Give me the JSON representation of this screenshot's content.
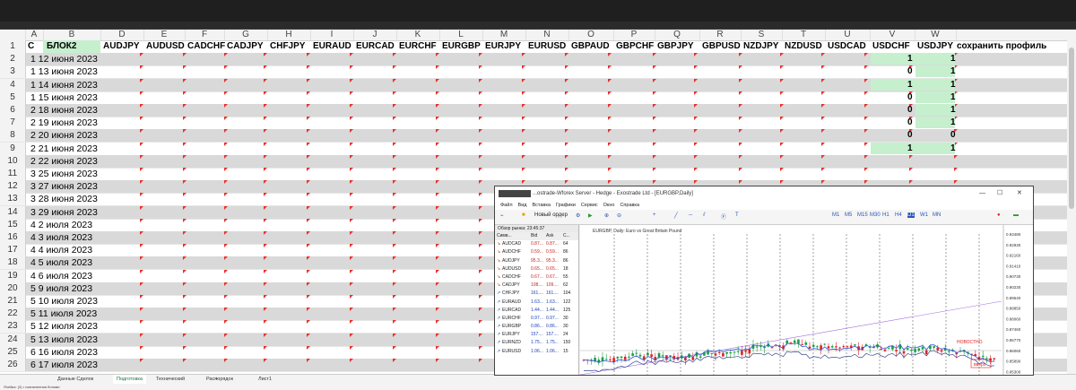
{
  "sheet": {
    "columns": [
      "A",
      "B",
      "D",
      "E",
      "F",
      "G",
      "H",
      "I",
      "J",
      "K",
      "L",
      "M",
      "N",
      "O",
      "P",
      "Q",
      "R",
      "S",
      "T",
      "U",
      "V",
      "W"
    ],
    "header_row": {
      "a": "С",
      "b": "БЛОК2",
      "pairs": [
        "AUDJPY",
        "AUDUSD",
        "CADCHF",
        "CADJPY",
        "CHFJPY",
        "EURAUD",
        "EURCAD",
        "EURCHF",
        "EURGBP",
        "EURJPY",
        "EURUSD",
        "GBPAUD",
        "GBPCHF",
        "GBPJPY",
        "GBPUSD",
        "NZDJPY",
        "NZDUSD",
        "USDCAD",
        "USDCHF",
        "USDJPY"
      ],
      "last": "сохранить профиль"
    },
    "rows": [
      {
        "n": "2",
        "a": "1",
        "date": "12 июня 2023",
        "v": "1",
        "w": "1"
      },
      {
        "n": "3",
        "a": "1",
        "date": "13 июня 2023",
        "v": "0",
        "w": "1"
      },
      {
        "n": "4",
        "a": "1",
        "date": "14 июня 2023",
        "v": "1",
        "w": "1"
      },
      {
        "n": "5",
        "a": "1",
        "date": "15 июня 2023",
        "v": "0",
        "w": "1"
      },
      {
        "n": "6",
        "a": "2",
        "date": "18 июня 2023",
        "v": "0",
        "w": "1"
      },
      {
        "n": "7",
        "a": "2",
        "date": "19 июня 2023",
        "v": "0",
        "w": "1"
      },
      {
        "n": "8",
        "a": "2",
        "date": "20 июня 2023",
        "v": "0",
        "w": "0"
      },
      {
        "n": "9",
        "a": "2",
        "date": "21 июня 2023",
        "v": "1",
        "w": "1"
      },
      {
        "n": "10",
        "a": "2",
        "date": "22 июня 2023",
        "v": "",
        "w": ""
      },
      {
        "n": "11",
        "a": "3",
        "date": "25 июня 2023",
        "v": "",
        "w": ""
      },
      {
        "n": "12",
        "a": "3",
        "date": "27 июня 2023",
        "v": "",
        "w": ""
      },
      {
        "n": "13",
        "a": "3",
        "date": "28 июня 2023",
        "v": "",
        "w": ""
      },
      {
        "n": "14",
        "a": "3",
        "date": "29 июня 2023",
        "v": "",
        "w": ""
      },
      {
        "n": "15",
        "a": "4",
        "date": "2 июля 2023",
        "v": "",
        "w": ""
      },
      {
        "n": "16",
        "a": "4",
        "date": "3 июля 2023",
        "v": "",
        "w": ""
      },
      {
        "n": "17",
        "a": "4",
        "date": "4 июля 2023",
        "v": "",
        "w": ""
      },
      {
        "n": "18",
        "a": "4",
        "date": "5 июля 2023",
        "v": "",
        "w": ""
      },
      {
        "n": "19",
        "a": "4",
        "date": "6 июля 2023",
        "v": "",
        "w": ""
      },
      {
        "n": "20",
        "a": "5",
        "date": "9 июля 2023",
        "v": "",
        "w": ""
      },
      {
        "n": "21",
        "a": "5",
        "date": "10 июля 2023",
        "v": "",
        "w": ""
      },
      {
        "n": "22",
        "a": "5",
        "date": "11 июля 2023",
        "v": "",
        "w": ""
      },
      {
        "n": "23",
        "a": "5",
        "date": "12 июля 2023",
        "v": "",
        "w": ""
      },
      {
        "n": "24",
        "a": "5",
        "date": "13 июля 2023",
        "v": "",
        "w": ""
      },
      {
        "n": "25",
        "a": "6",
        "date": "16 июля 2023",
        "v": "",
        "w": ""
      },
      {
        "n": "26",
        "a": "6",
        "date": "17 июля 2023",
        "v": "",
        "w": ""
      }
    ]
  },
  "tabs": [
    "Данные Сделок",
    "Подготовка",
    "Технический",
    "Распорядок",
    "Лист1"
  ],
  "mt4": {
    "title": "...ostrade-Wforex Server - Hedge - Exostrade Ltd - [EURGBP,Daily]",
    "menu": [
      "Файл",
      "Вид",
      "Вставка",
      "Графики",
      "Сервис",
      "Окно",
      "Справка"
    ],
    "new_order": "Новый ордер",
    "timeframes": [
      "M1",
      "M5",
      "M15",
      "M30",
      "H1",
      "H4",
      "D1",
      "W1",
      "MN"
    ],
    "market_watch_header": "Обзор рынка: 23:45:37",
    "mw_cols": [
      "Симв...",
      "Bid",
      "Ask",
      "С..."
    ],
    "symbols": [
      {
        "s": "AUDCAD",
        "b": "0.87...",
        "a": "0.87...",
        "sp": "64"
      },
      {
        "s": "AUDCHF",
        "b": "0.59...",
        "a": "0.59...",
        "sp": "86"
      },
      {
        "s": "AUDJPY",
        "b": "95.3...",
        "a": "95.3...",
        "sp": "86"
      },
      {
        "s": "AUDUSD",
        "b": "0.65...",
        "a": "0.65...",
        "sp": "18"
      },
      {
        "s": "CADCHF",
        "b": "0.67...",
        "a": "0.67...",
        "sp": "55"
      },
      {
        "s": "CADJPY",
        "b": "108....",
        "a": "109....",
        "sp": "62"
      },
      {
        "s": "CHFJPY",
        "b": "161....",
        "a": "161....",
        "sp": "104"
      },
      {
        "s": "EURAUD",
        "b": "1.63...",
        "a": "1.63...",
        "sp": "122"
      },
      {
        "s": "EURCAD",
        "b": "1.44...",
        "a": "1.44...",
        "sp": "125"
      },
      {
        "s": "EURCHF",
        "b": "0.97...",
        "a": "0.97...",
        "sp": "30"
      },
      {
        "s": "EURGBP",
        "b": "0.86...",
        "a": "0.86...",
        "sp": "30"
      },
      {
        "s": "EURJPY",
        "b": "157....",
        "a": "157....",
        "sp": "24"
      },
      {
        "s": "EURNZD",
        "b": "1.75...",
        "a": "1.75...",
        "sp": "150"
      },
      {
        "s": "EURUSD",
        "b": "1.06...",
        "a": "1.06...",
        "sp": "15"
      }
    ],
    "chart_label": "EURGBP, Daily:  Euro vs Great Britain Pound",
    "label_red1": "НОВОСТНО",
    "label_red2": "вверх",
    "prices": [
      "0.93480",
      "0.92930",
      "0.92160",
      "0.91410",
      "0.90730",
      "0.90230",
      "0.89540",
      "0.88850",
      "0.88060",
      "0.87460",
      "0.86770",
      "0.86060",
      "0.85890",
      "0.85300"
    ]
  },
  "status": "Ячейка: (3) • назначенная ботами"
}
